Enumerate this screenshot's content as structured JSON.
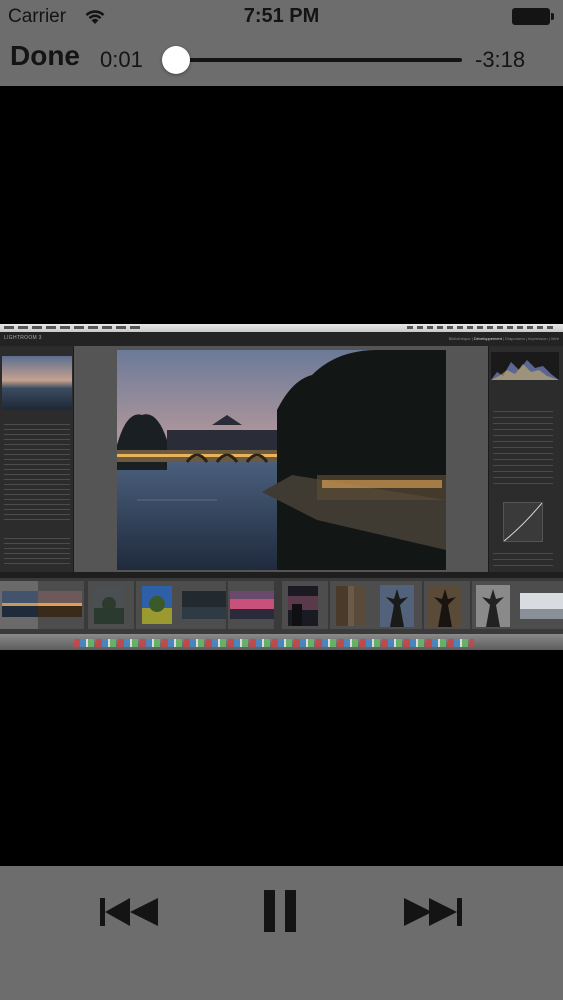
{
  "status_bar": {
    "carrier": "Carrier",
    "time": "7:51 PM"
  },
  "player": {
    "done_label": "Done",
    "elapsed": "0:01",
    "remaining": "-3:18",
    "progress_fraction": 0.005
  },
  "video_content": {
    "app_logo": "LIGHTROOM 3",
    "modules": [
      "Bibliothèque",
      "Développement",
      "Diaporama",
      "Impression",
      "Web"
    ],
    "active_module": "Développement"
  },
  "colors": {
    "chrome_background": "#6d6d6d",
    "text_dark": "#141414",
    "video_background": "#000000",
    "thumb_white": "#ffffff"
  },
  "icons": [
    "wifi-icon",
    "battery-icon",
    "previous-track-icon",
    "pause-icon",
    "next-track-icon"
  ]
}
